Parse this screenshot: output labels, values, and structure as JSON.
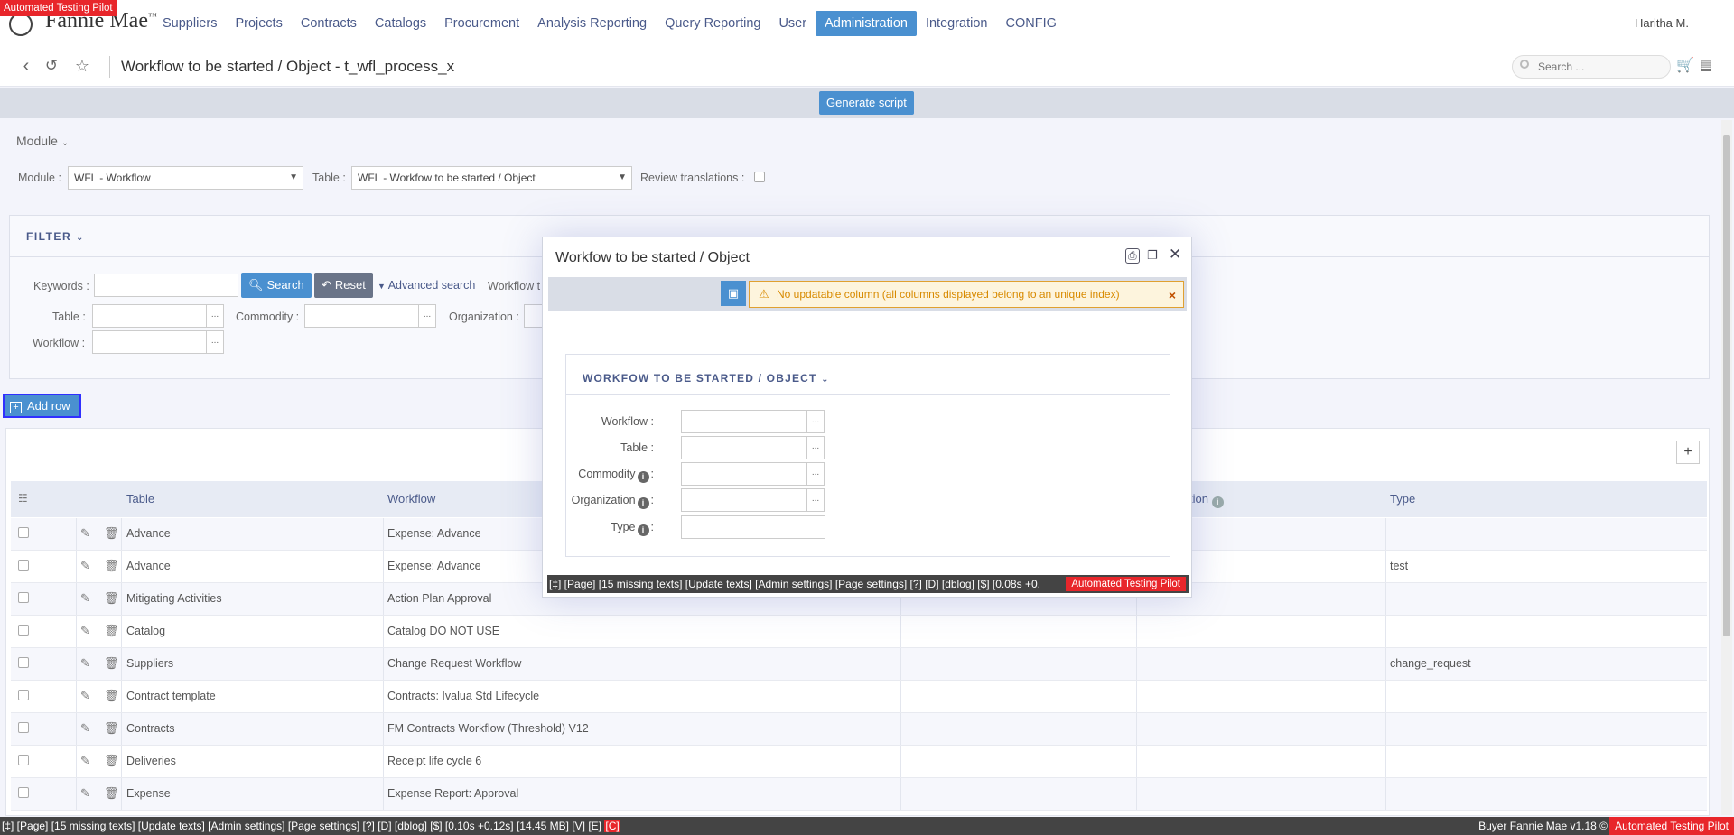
{
  "app": {
    "badge": "Automated Testing Pilot",
    "logo": "Fannie Mae",
    "logo_mark": "™",
    "user": "Haritha M."
  },
  "nav": [
    "Suppliers",
    "Projects",
    "Contracts",
    "Catalogs",
    "Procurement",
    "Analysis Reporting",
    "Query Reporting",
    "User",
    "Administration",
    "Integration",
    "CONFIG"
  ],
  "nav_active": "Administration",
  "header": {
    "title": "Workflow to be started / Object - t_wfl_process_x",
    "search_placeholder": "Search ..."
  },
  "generate_btn": "Generate script",
  "module": {
    "toggle": "Module",
    "module_label": "Module :",
    "module_value": "WFL - Workflow",
    "table_label": "Table :",
    "table_value": "WFL - Workfow to be started / Object",
    "review_label": "Review translations :"
  },
  "filter": {
    "title": "FILTER",
    "keywords_label": "Keywords :",
    "search_btn": "Search",
    "reset_btn": "Reset",
    "advanced": "Advanced search",
    "workflow_trunc": "Workflow t",
    "table_label": "Table :",
    "commodity_label": "Commodity :",
    "organization_label": "Organization :",
    "workflow_label": "Workflow :"
  },
  "add_row_btn": "Add row",
  "grid": {
    "columns": [
      "Table",
      "Workflow",
      "",
      "tion",
      "Type"
    ],
    "rows": [
      {
        "table": "Advance",
        "workflow": "Expense: Advance",
        "type": ""
      },
      {
        "table": "Advance",
        "workflow": "Expense: Advance",
        "type": "test"
      },
      {
        "table": "Mitigating Activities",
        "workflow": "Action Plan Approval",
        "type": ""
      },
      {
        "table": "Catalog",
        "workflow": "Catalog DO NOT USE",
        "type": ""
      },
      {
        "table": "Suppliers",
        "workflow": "Change Request Workflow",
        "type": "change_request"
      },
      {
        "table": "Contract template",
        "workflow": "Contracts: Ivalua Std Lifecycle",
        "type": ""
      },
      {
        "table": "Contracts",
        "workflow": "FM Contracts Workflow (Threshold) V12",
        "type": ""
      },
      {
        "table": "Deliveries",
        "workflow": "Receipt life cycle 6",
        "type": ""
      },
      {
        "table": "Expense",
        "workflow": "Expense Report: Approval",
        "type": ""
      }
    ]
  },
  "status": {
    "text": "[‡] [Page] [15 missing texts] [Update texts] [Admin settings] [Page settings] [?] [D] [dblog] [$] [0.10s +0.12s] [14.45 MB] [V] [E] ",
    "c": "[C]",
    "version": "Buyer Fannie Mae v1.18 ©",
    "atp": "Automated Testing Pilot"
  },
  "modal": {
    "title": "Workfow to be started / Object",
    "warning": "No updatable column (all columns displayed belong to an unique index)",
    "section_title": "WORKFOW TO BE STARTED / OBJECT",
    "fields": [
      "Workflow :",
      "Table :",
      "Commodity",
      "Organization",
      "Type"
    ],
    "status": "[‡] [Page] [15 missing texts] [Update texts] [Admin settings] [Page settings] [?] [D] [dblog] [$] [0.08s +0.",
    "atp": "Automated Testing Pilot"
  },
  "colors": {
    "accent": "#4a90d0",
    "warning_bg": "#fdf4dd",
    "warning_text": "#d88a00",
    "badge_red": "#e8262b"
  }
}
